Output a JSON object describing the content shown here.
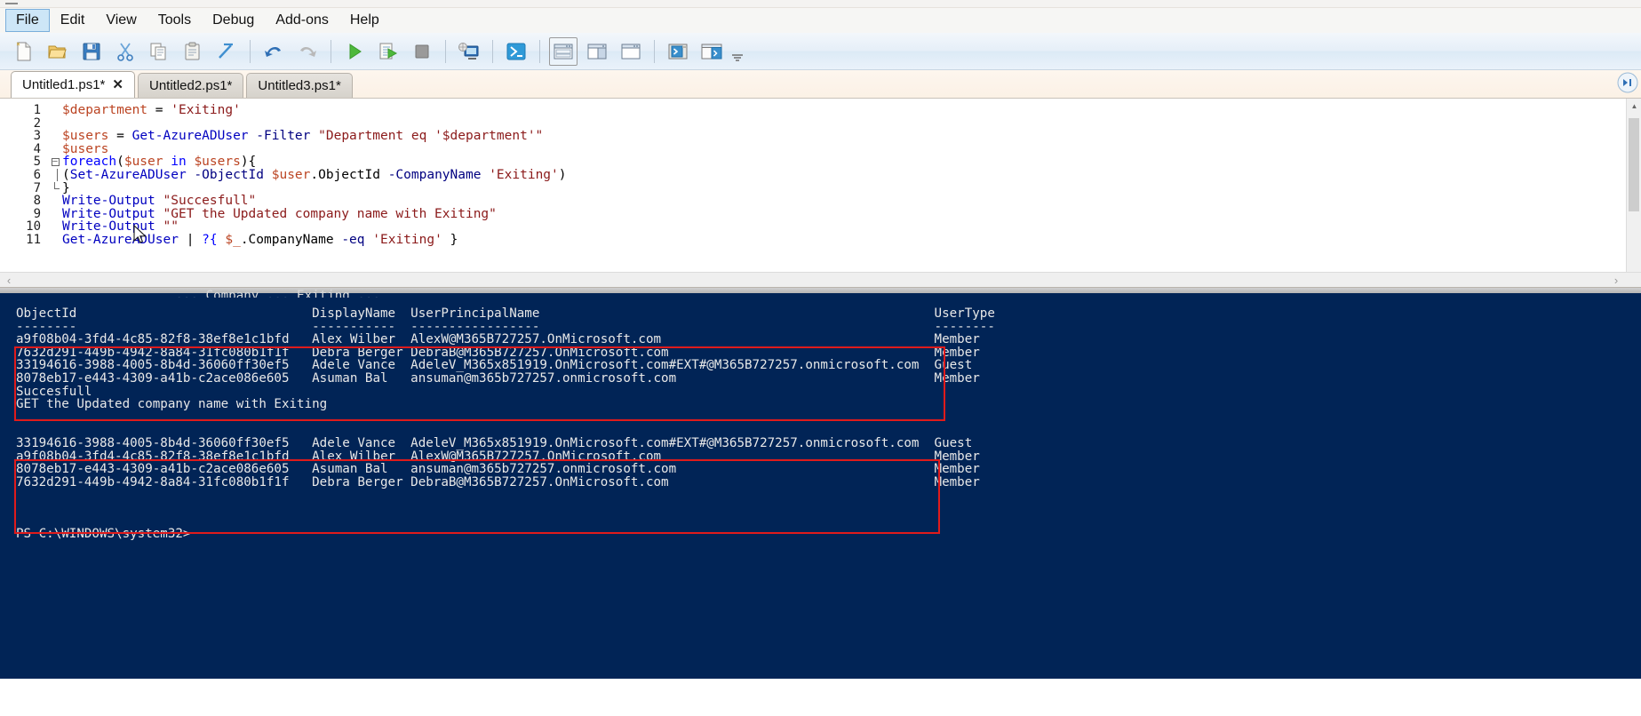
{
  "window": {
    "title_fragment": ""
  },
  "menu": {
    "items": [
      {
        "label": "File",
        "selected": true
      },
      {
        "label": "Edit",
        "selected": false
      },
      {
        "label": "View",
        "selected": false
      },
      {
        "label": "Tools",
        "selected": false
      },
      {
        "label": "Debug",
        "selected": false
      },
      {
        "label": "Add-ons",
        "selected": false
      },
      {
        "label": "Help",
        "selected": false
      }
    ]
  },
  "toolbar": {
    "buttons": [
      {
        "name": "new-script-icon",
        "tip": "New"
      },
      {
        "name": "open-script-icon",
        "tip": "Open"
      },
      {
        "name": "save-icon",
        "tip": "Save"
      },
      {
        "name": "cut-icon",
        "tip": "Cut"
      },
      {
        "name": "copy-icon",
        "tip": "Copy"
      },
      {
        "name": "paste-icon",
        "tip": "Paste"
      },
      {
        "name": "clear-console-icon",
        "tip": "Clear Console Pane"
      },
      {
        "name": "undo-icon",
        "tip": "Undo"
      },
      {
        "name": "redo-icon",
        "tip": "Redo"
      },
      {
        "name": "run-script-icon",
        "tip": "Run Script"
      },
      {
        "name": "run-selection-icon",
        "tip": "Run Selection"
      },
      {
        "name": "stop-operation-icon",
        "tip": "Stop Operation"
      },
      {
        "name": "new-remote-tab-icon",
        "tip": "New Remote PowerShell Tab"
      },
      {
        "name": "start-powershell-icon",
        "tip": "Start PowerShell.exe"
      },
      {
        "name": "layout-stacked-icon",
        "tip": "Show Script Pane Top"
      },
      {
        "name": "layout-side-by-side-icon",
        "tip": "Show Script Pane Right"
      },
      {
        "name": "layout-maximized-icon",
        "tip": "Show Script Pane Maximized"
      },
      {
        "name": "show-command-addon-icon",
        "tip": "Show Command Add-on"
      },
      {
        "name": "show-command-window-icon",
        "tip": "Show Command Window"
      }
    ],
    "overflow_label": "–"
  },
  "tabs": [
    {
      "label": "Untitled1.ps1*",
      "active": true,
      "close": "✕"
    },
    {
      "label": "Untitled2.ps1*",
      "active": false,
      "close": ""
    },
    {
      "label": "Untitled3.ps1*",
      "active": false,
      "close": ""
    }
  ],
  "editor": {
    "lines": [
      {
        "n": "1",
        "fold": "none",
        "tokens": [
          {
            "t": "$department",
            "c": "var"
          },
          {
            "t": " ",
            "c": "plain"
          },
          {
            "t": "=",
            "c": "op"
          },
          {
            "t": " ",
            "c": "plain"
          },
          {
            "t": "'Exiting'",
            "c": "str"
          }
        ]
      },
      {
        "n": "2",
        "fold": "none",
        "tokens": []
      },
      {
        "n": "3",
        "fold": "none",
        "tokens": [
          {
            "t": "$users",
            "c": "var"
          },
          {
            "t": " = ",
            "c": "op"
          },
          {
            "t": "Get-AzureADUser",
            "c": "cmd"
          },
          {
            "t": " ",
            "c": "plain"
          },
          {
            "t": "-Filter",
            "c": "param"
          },
          {
            "t": " ",
            "c": "plain"
          },
          {
            "t": "\"Department eq '$department'\"",
            "c": "str"
          }
        ]
      },
      {
        "n": "4",
        "fold": "none",
        "tokens": [
          {
            "t": "$users",
            "c": "var"
          }
        ]
      },
      {
        "n": "5",
        "fold": "start",
        "tokens": [
          {
            "t": "foreach",
            "c": "kw"
          },
          {
            "t": "(",
            "c": "op"
          },
          {
            "t": "$user",
            "c": "var"
          },
          {
            "t": " ",
            "c": "plain"
          },
          {
            "t": "in",
            "c": "kw"
          },
          {
            "t": " ",
            "c": "plain"
          },
          {
            "t": "$users",
            "c": "var"
          },
          {
            "t": "){",
            "c": "op"
          }
        ]
      },
      {
        "n": "6",
        "fold": "bar",
        "tokens": [
          {
            "t": "(",
            "c": "op"
          },
          {
            "t": "Set-AzureADUser",
            "c": "cmd"
          },
          {
            "t": " ",
            "c": "plain"
          },
          {
            "t": "-ObjectId",
            "c": "param"
          },
          {
            "t": " ",
            "c": "plain"
          },
          {
            "t": "$user",
            "c": "var"
          },
          {
            "t": ".ObjectId",
            "c": "prop"
          },
          {
            "t": " ",
            "c": "plain"
          },
          {
            "t": "-CompanyName",
            "c": "param"
          },
          {
            "t": " ",
            "c": "plain"
          },
          {
            "t": "'Exiting'",
            "c": "str"
          },
          {
            "t": ")",
            "c": "op"
          }
        ]
      },
      {
        "n": "7",
        "fold": "end",
        "tokens": [
          {
            "t": "}",
            "c": "op"
          }
        ]
      },
      {
        "n": "8",
        "fold": "none",
        "tokens": [
          {
            "t": "Write-Output",
            "c": "cmd"
          },
          {
            "t": " ",
            "c": "plain"
          },
          {
            "t": "\"Succesfull\"",
            "c": "str"
          }
        ]
      },
      {
        "n": "9",
        "fold": "none",
        "tokens": [
          {
            "t": "Write-Output",
            "c": "cmd"
          },
          {
            "t": " ",
            "c": "plain"
          },
          {
            "t": "\"GET the Updated company name with Exiting\"",
            "c": "str"
          }
        ]
      },
      {
        "n": "10",
        "fold": "none",
        "tokens": [
          {
            "t": "Write-Output",
            "c": "cmd"
          },
          {
            "t": " ",
            "c": "plain"
          },
          {
            "t": "\"\"",
            "c": "str"
          }
        ]
      },
      {
        "n": "11",
        "fold": "none",
        "tokens": [
          {
            "t": "Get-AzureADUser",
            "c": "cmd"
          },
          {
            "t": " ",
            "c": "plain"
          },
          {
            "t": "|",
            "c": "op"
          },
          {
            "t": " ",
            "c": "plain"
          },
          {
            "t": "?{",
            "c": "kw"
          },
          {
            "t": " ",
            "c": "plain"
          },
          {
            "t": "$_",
            "c": "var"
          },
          {
            "t": ".CompanyName",
            "c": "prop"
          },
          {
            "t": " ",
            "c": "plain"
          },
          {
            "t": "-eq",
            "c": "param"
          },
          {
            "t": " ",
            "c": "plain"
          },
          {
            "t": "'Exiting'",
            "c": "str"
          },
          {
            "t": " }",
            "c": "op"
          }
        ]
      }
    ],
    "scroll": {
      "h_left_arrow": "‹",
      "h_right_arrow": "›",
      "v_up_arrow": "▲",
      "v_down_arrow": "▼"
    }
  },
  "console": {
    "clipped_partial_line": "                     ... Company ... Exiting ...",
    "table1": {
      "headers": [
        "ObjectId",
        "DisplayName",
        "UserPrincipalName",
        "UserType"
      ],
      "underlines": [
        "--------",
        "-----------",
        "-----------------",
        "--------"
      ],
      "rows": [
        {
          "ObjectId": "a9f08b04-3fd4-4c85-82f8-38ef8e1c1bfd",
          "DisplayName": "Alex Wilber",
          "UserPrincipalName": "AlexW@M365B727257.OnMicrosoft.com",
          "UserType": "Member"
        },
        {
          "ObjectId": "7632d291-449b-4942-8a84-31fc080b1f1f",
          "DisplayName": "Debra Berger",
          "UserPrincipalName": "DebraB@M365B727257.OnMicrosoft.com",
          "UserType": "Member"
        },
        {
          "ObjectId": "33194616-3988-4005-8b4d-36060ff30ef5",
          "DisplayName": "Adele Vance",
          "UserPrincipalName": "AdeleV_M365x851919.OnMicrosoft.com#EXT#@M365B727257.onmicrosoft.com",
          "UserType": "Guest"
        },
        {
          "ObjectId": "8078eb17-e443-4309-a41b-c2ace086e605",
          "DisplayName": "Asuman Bal",
          "UserPrincipalName": "ansuman@m365b727257.onmicrosoft.com",
          "UserType": "Member"
        }
      ]
    },
    "messages": [
      "Succesfull",
      "GET the Updated company name with Exiting"
    ],
    "table2": {
      "rows": [
        {
          "ObjectId": "33194616-3988-4005-8b4d-36060ff30ef5",
          "DisplayName": "Adele Vance",
          "UserPrincipalName": "AdeleV_M365x851919.OnMicrosoft.com#EXT#@M365B727257.onmicrosoft.com",
          "UserType": "Guest"
        },
        {
          "ObjectId": "a9f08b04-3fd4-4c85-82f8-38ef8e1c1bfd",
          "DisplayName": "Alex Wilber",
          "UserPrincipalName": "AlexW@M365B727257.OnMicrosoft.com",
          "UserType": "Member"
        },
        {
          "ObjectId": "8078eb17-e443-4309-a41b-c2ace086e605",
          "DisplayName": "Asuman Bal",
          "UserPrincipalName": "ansuman@m365b727257.onmicrosoft.com",
          "UserType": "Member"
        },
        {
          "ObjectId": "7632d291-449b-4942-8a84-31fc080b1f1f",
          "DisplayName": "Debra Berger",
          "UserPrincipalName": "DebraB@M365B727257.OnMicrosoft.com",
          "UserType": "Member"
        }
      ]
    },
    "prompt": "PS C:\\WINDOWS\\system32>",
    "background_color": "#012456",
    "highlight_color": "#e01b1b"
  }
}
